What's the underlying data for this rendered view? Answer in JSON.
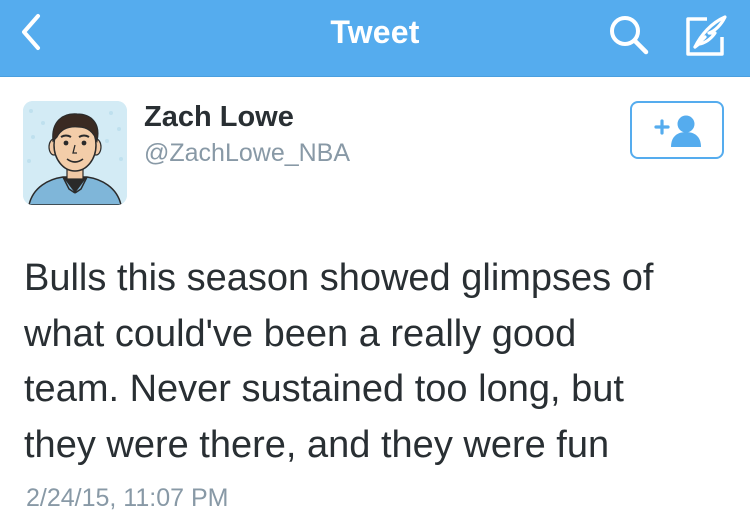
{
  "colors": {
    "nav_background": "#55acee",
    "nav_foreground": "#ffffff",
    "name_text": "#292f33",
    "secondary_text": "#8899a6",
    "accent": "#55acee"
  },
  "navbar": {
    "title": "Tweet",
    "back_icon": "chevron-left-icon",
    "search_icon": "search-icon",
    "compose_icon": "compose-tweet-icon"
  },
  "author": {
    "name": "Zach Lowe",
    "handle": "@ZachLowe_NBA",
    "avatar": "cartoon-avatar"
  },
  "follow_button": {
    "icon": "add-user-icon"
  },
  "tweet": {
    "text": "Bulls this season showed glimpses of\nwhat could've been a really good\nteam. Never sustained too long, but\nthey were there, and they were fun",
    "timestamp": "2/24/15, 11:07 PM"
  }
}
